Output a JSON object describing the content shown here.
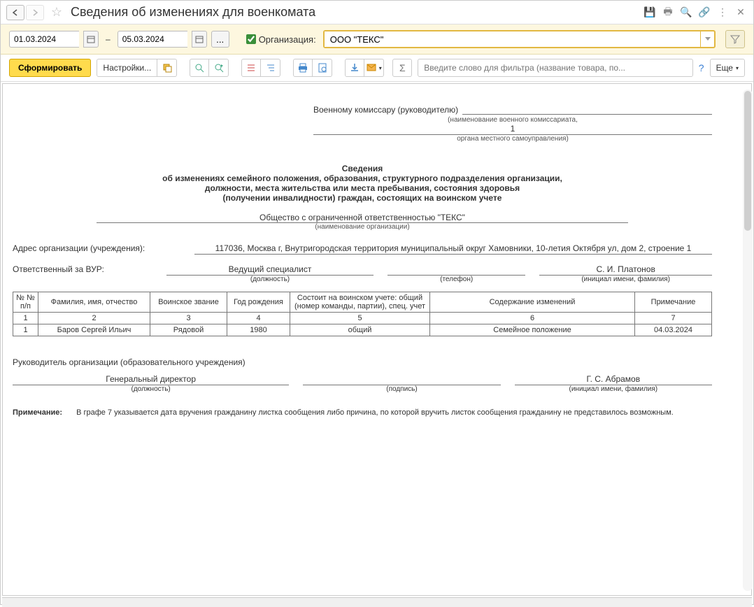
{
  "title": "Сведения об изменениях для военкомата",
  "period": {
    "from": "01.03.2024",
    "to": "05.03.2024"
  },
  "org": {
    "label": "Организация:",
    "value": "ООО \"ТЕКС\""
  },
  "toolbar": {
    "generate": "Сформировать",
    "settings": "Настройки...",
    "more": "Еще",
    "search_placeholder": "Введите слово для фильтра (название товара, по..."
  },
  "report": {
    "addressee_label": "Военному комиссару (руководителю)",
    "addressee_hint1": "(наименование военного комиссариата,",
    "addressee_val2": "1",
    "addressee_hint2": "органа местного самоуправления)",
    "heading1": "Сведения",
    "heading2": "об изменениях семейного положения, образования, структурного подразделения организации,",
    "heading3": "должности, места жительства или места пребывания, состояния здоровья",
    "heading4": "(получении инвалидности) граждан, состоящих на воинском учете",
    "org_full": "Общество с ограниченной ответственностью \"ТЕКС\"",
    "org_hint": "(наименование организации)",
    "address_label": "Адрес организации (учреждения):",
    "address_value": "117036, Москва г, Внутригородская территория муниципальный округ Хамовники, 10-летия Октября ул, дом 2, строение 1",
    "resp_label": "Ответственный за ВУР:",
    "resp_position": "Ведущий специалист",
    "resp_position_hint": "(должность)",
    "resp_phone_hint": "(телефон)",
    "resp_name": "С. И. Платонов",
    "resp_name_hint": "(инициал имени, фамилия)",
    "cols": [
      "№ № п/п",
      "Фамилия, имя, отчество",
      "Воинское звание",
      "Год рождения",
      "Состоит на воинском учете: общий (номер команды, партии), спец. учет",
      "Содержание изменений",
      "Примечание"
    ],
    "col_nums": [
      "1",
      "2",
      "3",
      "4",
      "5",
      "6",
      "7"
    ],
    "rows": [
      {
        "n": "1",
        "fio": "Баров Сергей Ильич",
        "rank": "Рядовой",
        "year": "1980",
        "acct": "общий",
        "change": "Семейное положение",
        "note": "04.03.2024"
      }
    ],
    "mgr_label": "Руководитель организации (образовательного учреждения)",
    "mgr_position": "Генеральный директор",
    "mgr_position_hint": "(должность)",
    "mgr_sign_hint": "(подпись)",
    "mgr_name": "Г. С. Абрамов",
    "mgr_name_hint": "(инициал имени, фамилия)",
    "footnote_label": "Примечание:",
    "footnote": "В графе 7 указывается дата вручения гражданину листка сообщения либо причина, по которой вручить листок сообщения гражданину не представилось возможным."
  }
}
